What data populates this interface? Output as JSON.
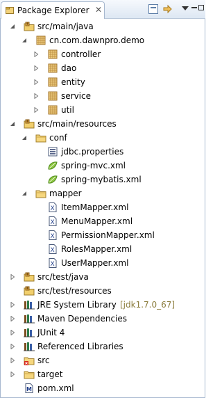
{
  "view": {
    "tab_title": "Package Explorer",
    "tab_close": "✕"
  },
  "tree": [
    {
      "label": "src/main/java",
      "icon": "source-folder-icon",
      "expanded": true
    },
    {
      "label": "cn.com.dawnpro.demo",
      "icon": "package-icon",
      "expanded": true
    },
    {
      "label": "controller",
      "icon": "package-icon",
      "expanded": false
    },
    {
      "label": "dao",
      "icon": "package-icon",
      "expanded": false
    },
    {
      "label": "entity",
      "icon": "package-icon",
      "expanded": false
    },
    {
      "label": "service",
      "icon": "package-icon",
      "expanded": false
    },
    {
      "label": "util",
      "icon": "package-icon",
      "expanded": false
    },
    {
      "label": "src/main/resources",
      "icon": "source-folder-icon",
      "expanded": true
    },
    {
      "label": "conf",
      "icon": "folder-icon",
      "expanded": true
    },
    {
      "label": "jdbc.properties",
      "icon": "properties-file-icon"
    },
    {
      "label": "spring-mvc.xml",
      "icon": "spring-leaf-icon"
    },
    {
      "label": "spring-mybatis.xml",
      "icon": "spring-leaf-icon"
    },
    {
      "label": "mapper",
      "icon": "folder-icon",
      "expanded": true
    },
    {
      "label": "ItemMapper.xml",
      "icon": "xml-file-icon"
    },
    {
      "label": "MenuMapper.xml",
      "icon": "xml-file-icon"
    },
    {
      "label": "PermissionMapper.xml",
      "icon": "xml-file-icon"
    },
    {
      "label": "RolesMapper.xml",
      "icon": "xml-file-icon"
    },
    {
      "label": "UserMapper.xml",
      "icon": "xml-file-icon"
    },
    {
      "label": "src/test/java",
      "icon": "source-folder-icon",
      "expanded": false
    },
    {
      "label": "src/test/resources",
      "icon": "source-folder-icon"
    },
    {
      "label": "JRE System Library",
      "decoration": "[jdk1.7.0_67]",
      "icon": "library-icon",
      "expanded": false
    },
    {
      "label": "Maven Dependencies",
      "icon": "library-icon",
      "expanded": false
    },
    {
      "label": "JUnit 4",
      "icon": "library-icon",
      "expanded": false
    },
    {
      "label": "Referenced Libraries",
      "icon": "library-icon",
      "expanded": false
    },
    {
      "label": "src",
      "icon": "error-folder-icon",
      "expanded": false
    },
    {
      "label": "target",
      "icon": "folder-icon",
      "expanded": false
    },
    {
      "label": "pom.xml",
      "icon": "maven-pom-icon"
    }
  ]
}
